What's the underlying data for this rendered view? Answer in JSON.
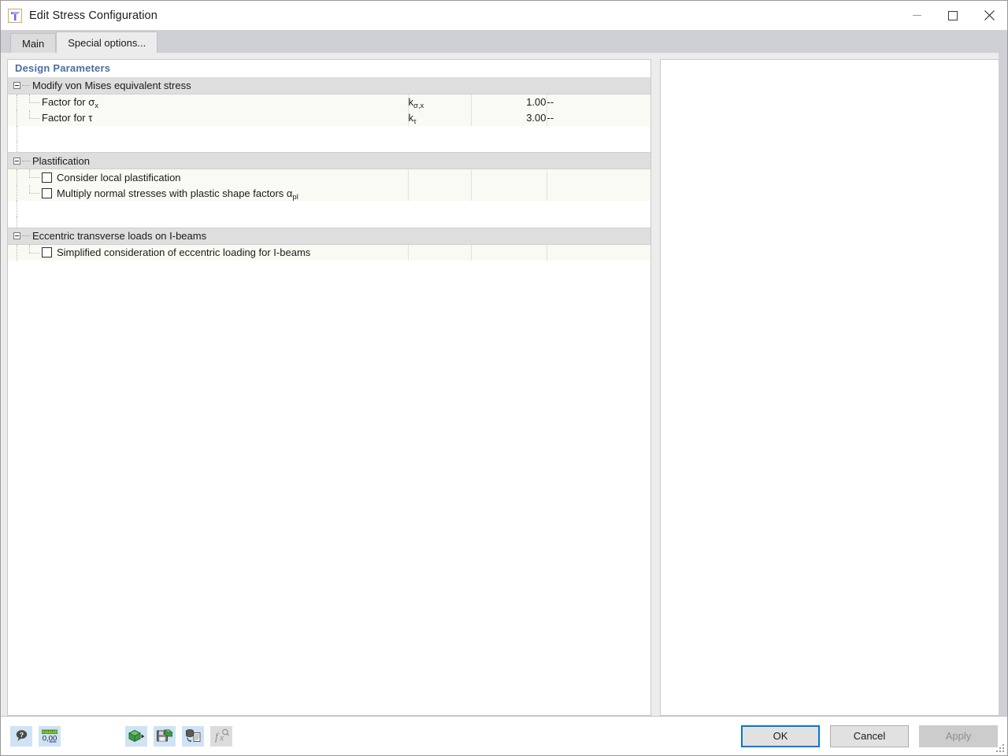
{
  "window": {
    "title": "Edit Stress Configuration",
    "app_icon": "t-beam-profile-icon",
    "controls": {
      "minimize": "minimize-icon",
      "maximize": "maximize-icon",
      "close": "close-icon"
    }
  },
  "tabs": [
    {
      "label": "Main",
      "active": false
    },
    {
      "label": "Special options...",
      "active": true
    }
  ],
  "table": {
    "caption": "Design Parameters",
    "groups": [
      {
        "label": "Modify von Mises equivalent stress",
        "expanded": true,
        "rows": [
          {
            "label": "Factor for σ",
            "label_sub": "x",
            "symbol": "k",
            "symbol_sub": "σ,x",
            "value": "1.00",
            "unit": "--",
            "type": "value"
          },
          {
            "label": "Factor for τ",
            "label_sub": "",
            "symbol": "k",
            "symbol_sub": "τ",
            "value": "3.00",
            "unit": "--",
            "type": "value"
          }
        ]
      },
      {
        "label": "Plastification",
        "expanded": true,
        "rows": [
          {
            "label": "Consider local plastification",
            "label_sub": "",
            "symbol": "",
            "symbol_sub": "",
            "value": "",
            "unit": "",
            "type": "checkbox",
            "checked": false
          },
          {
            "label": "Multiply normal stresses with plastic shape factors α",
            "label_sub": "pl",
            "symbol": "",
            "symbol_sub": "",
            "value": "",
            "unit": "",
            "type": "checkbox",
            "checked": false
          }
        ]
      },
      {
        "label": "Eccentric transverse loads on I-beams",
        "expanded": true,
        "rows": [
          {
            "label": "Simplified consideration of eccentric loading for I-beams",
            "label_sub": "",
            "symbol": "",
            "symbol_sub": "",
            "value": "",
            "unit": "",
            "type": "checkbox",
            "checked": false
          }
        ]
      }
    ]
  },
  "footer": {
    "tools": [
      {
        "name": "help-icon",
        "enabled": true
      },
      {
        "name": "units-and-decimals-icon",
        "enabled": true
      },
      {
        "name": "import-from-library-icon",
        "enabled": true
      },
      {
        "name": "save-to-library-icon",
        "enabled": true
      },
      {
        "name": "load-default-values-icon",
        "enabled": true
      },
      {
        "name": "formula-fx-icon",
        "enabled": false
      }
    ],
    "buttons": {
      "ok": "OK",
      "cancel": "Cancel",
      "apply": "Apply"
    }
  },
  "colors": {
    "accent": "#0078d7",
    "caption_text": "#4a6fa5",
    "group_row_bg": "#dedede",
    "data_row_bg": "#fafaf4",
    "window_chrome": "#cfcfd6",
    "body_bg": "#ececec"
  }
}
